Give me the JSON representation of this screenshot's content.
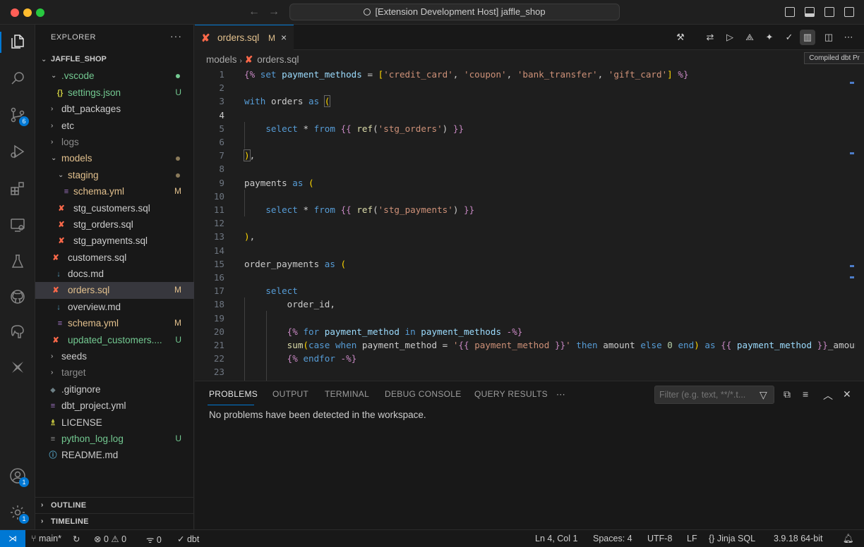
{
  "window": {
    "title": "[Extension Development Host] jaffle_shop"
  },
  "activity_bar": {
    "items": [
      {
        "name": "explorer-icon",
        "badge": ""
      },
      {
        "name": "search-icon",
        "badge": ""
      },
      {
        "name": "source-control-icon",
        "badge": "6"
      },
      {
        "name": "run-debug-icon",
        "badge": ""
      },
      {
        "name": "extensions-icon",
        "badge": ""
      },
      {
        "name": "remote-explorer-icon",
        "badge": ""
      },
      {
        "name": "testing-icon",
        "badge": ""
      },
      {
        "name": "github-icon",
        "badge": ""
      },
      {
        "name": "postgres-icon",
        "badge": ""
      },
      {
        "name": "dbt-icon",
        "badge": ""
      }
    ],
    "accounts_badge": "1",
    "settings_badge": "1"
  },
  "sidebar": {
    "title": "EXPLORER",
    "more": "···",
    "root": "JAFFLE_SHOP",
    "files": [
      {
        "label": ".vscode",
        "deco": "",
        "status": "untracked"
      },
      {
        "label": "settings.json",
        "deco": "U",
        "status": "untracked",
        "icon": "{}"
      },
      {
        "label": "dbt_packages",
        "deco": "",
        "status": "normal"
      },
      {
        "label": "etc",
        "deco": "",
        "status": "normal"
      },
      {
        "label": "logs",
        "deco": "",
        "status": "ignored"
      },
      {
        "label": "models",
        "deco": "",
        "status": "mod"
      },
      {
        "label": "staging",
        "deco": "",
        "status": "mod"
      },
      {
        "label": "schema.yml",
        "deco": "M",
        "status": "mod",
        "icon": "≡"
      },
      {
        "label": "stg_customers.sql",
        "deco": "",
        "status": "normal"
      },
      {
        "label": "stg_orders.sql",
        "deco": "",
        "status": "normal"
      },
      {
        "label": "stg_payments.sql",
        "deco": "",
        "status": "normal"
      },
      {
        "label": "customers.sql",
        "deco": "",
        "status": "normal"
      },
      {
        "label": "docs.md",
        "deco": "",
        "status": "normal",
        "icon": "↓"
      },
      {
        "label": "orders.sql",
        "deco": "M",
        "status": "mod"
      },
      {
        "label": "overview.md",
        "deco": "",
        "status": "normal",
        "icon": "↓"
      },
      {
        "label": "schema.yml",
        "deco": "M",
        "status": "mod",
        "icon": "≡"
      },
      {
        "label": "updated_customers....",
        "deco": "U",
        "status": "untracked"
      },
      {
        "label": "seeds",
        "deco": "",
        "status": "normal"
      },
      {
        "label": "target",
        "deco": "",
        "status": "ignored"
      },
      {
        "label": ".gitignore",
        "deco": "",
        "status": "normal",
        "icon": "◆"
      },
      {
        "label": "dbt_project.yml",
        "deco": "",
        "status": "normal",
        "icon": "≡"
      },
      {
        "label": "LICENSE",
        "deco": "",
        "status": "normal",
        "icon": "♗"
      },
      {
        "label": "python_log.log",
        "deco": "U",
        "status": "untracked",
        "icon": "≡"
      },
      {
        "label": "README.md",
        "deco": "",
        "status": "normal",
        "icon": "ⓘ"
      }
    ],
    "outline": "OUTLINE",
    "timeline": "TIMELINE"
  },
  "editor": {
    "tab": {
      "label": "orders.sql",
      "mark": "M",
      "close": "×"
    },
    "breadcrumb": {
      "folder": "models",
      "file": "orders.sql"
    },
    "tooltip": "Compiled dbt Pr",
    "line_numbers": [
      "1",
      "2",
      "3",
      "4",
      "5",
      "6",
      "7",
      "8",
      "9",
      "10",
      "11",
      "12",
      "13",
      "14",
      "15",
      "16",
      "17",
      "18",
      "19",
      "20",
      "21",
      "22",
      "23"
    ],
    "current_line": "4"
  },
  "panel": {
    "tabs": [
      "PROBLEMS",
      "OUTPUT",
      "TERMINAL",
      "DEBUG CONSOLE",
      "QUERY RESULTS"
    ],
    "more": "···",
    "filter_placeholder": "Filter (e.g. text, **/*.t...",
    "message": "No problems have been detected in the workspace."
  },
  "status_bar": {
    "branch": "main*",
    "errors": "0",
    "warnings": "0",
    "ports": "0",
    "dbt": "dbt",
    "position": "Ln 4, Col 1",
    "spaces": "Spaces: 4",
    "encoding": "UTF-8",
    "eol": "LF",
    "language": "Jinja SQL",
    "python": "3.9.18 64-bit"
  },
  "colors": {
    "accent": "#0078d4",
    "dbt_orange": "#ff694a",
    "modified": "#e2c08d",
    "untracked": "#73c991"
  }
}
